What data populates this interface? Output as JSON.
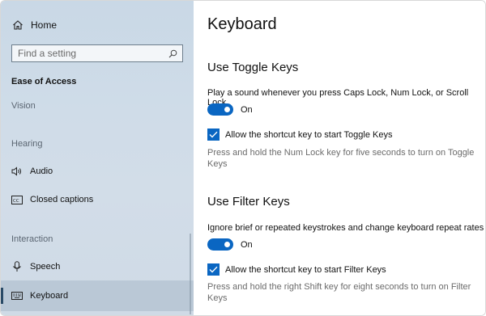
{
  "sidebar": {
    "home_label": "Home",
    "search_placeholder": "Find a setting",
    "section_title": "Ease of Access",
    "groups": {
      "vision": "Vision",
      "hearing": "Hearing",
      "interaction": "Interaction"
    },
    "items": {
      "audio": "Audio",
      "closed_captions": "Closed captions",
      "speech": "Speech",
      "keyboard": "Keyboard"
    },
    "icons": [
      "home-icon",
      "search-icon",
      "speaker-icon",
      "closed-captions-icon",
      "microphone-icon",
      "keyboard-icon"
    ]
  },
  "main": {
    "title": "Keyboard",
    "toggle_keys": {
      "heading": "Use Toggle Keys",
      "description": "Play a sound whenever you press Caps Lock, Num Lock, or Scroll Lock",
      "toggle_state": "On",
      "shortcut_label": "Allow the shortcut key to start Toggle Keys",
      "hint": "Press and hold the Num Lock key for five seconds to turn on Toggle Keys"
    },
    "filter_keys": {
      "heading": "Use Filter Keys",
      "description": "Ignore brief or repeated keystrokes and change keyboard repeat rates",
      "toggle_state": "On",
      "shortcut_label": "Allow the shortcut key to start Filter Keys",
      "hint": "Press and hold the right Shift key for eight seconds to turn on Filter Keys"
    }
  },
  "colors": {
    "accent": "#0a66c2",
    "sidebar_bg": "#cfdce8"
  }
}
